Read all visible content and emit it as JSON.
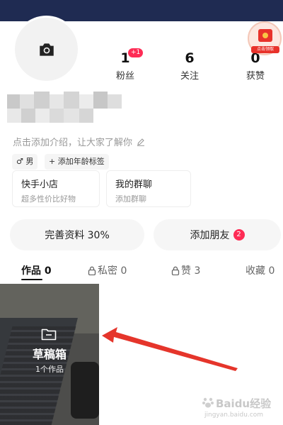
{
  "profile": {
    "stats": [
      {
        "value": "1",
        "label": "粉丝"
      },
      {
        "value": "6",
        "label": "关注"
      },
      {
        "value": "0",
        "label": "获赞"
      }
    ],
    "new_fans_badge": "+1",
    "bio_placeholder": "点击添加介绍，让大家了解你",
    "tags": {
      "gender": "♂ 男",
      "age": "+ 添加年龄标签"
    },
    "redpack_label": "点击领取"
  },
  "cards": [
    {
      "title": "快手小店",
      "subtitle": "超多性价比好物"
    },
    {
      "title": "我的群聊",
      "subtitle": "添加群聊"
    }
  ],
  "actions": {
    "complete_profile": "完善资料 30%",
    "add_friends": "添加朋友",
    "add_friends_count": "2",
    "profile_completion_percent": 30
  },
  "tabs": [
    {
      "label": "作品 0",
      "active": true
    },
    {
      "label": "私密 0",
      "locked": true
    },
    {
      "label": "赞 3",
      "locked": true
    },
    {
      "label": "收藏 0"
    }
  ],
  "draft": {
    "title": "草稿箱",
    "count": "1个作品"
  },
  "watermark": {
    "text": "Baidu经验",
    "url": "jingyan.baidu.com"
  },
  "colors": {
    "header": "#1f2b52",
    "accent": "#fe2c55",
    "arrow": "#e5352b"
  }
}
